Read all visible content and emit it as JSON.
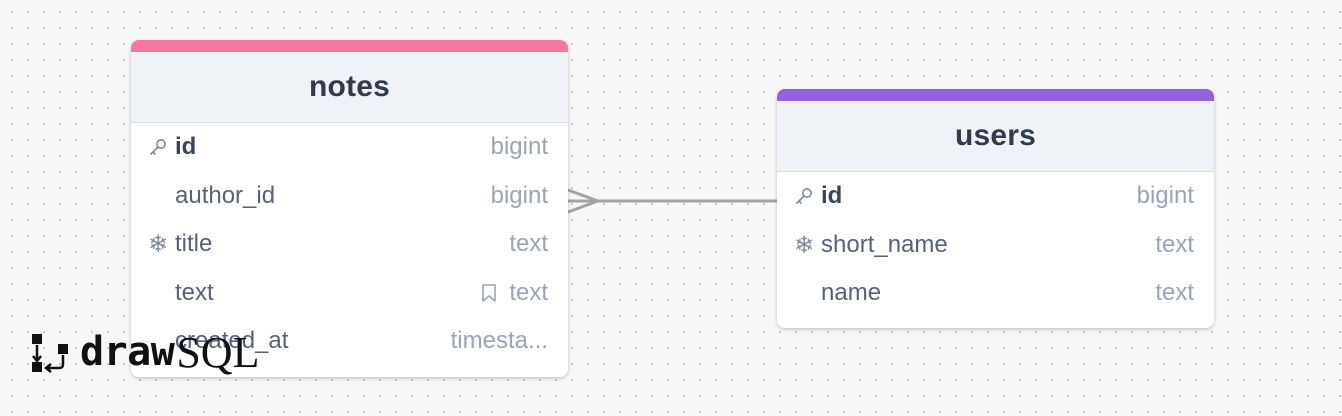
{
  "brand": {
    "logo_word_bold": "draw",
    "logo_word_light": "SQL"
  },
  "tables": {
    "notes": {
      "name": "notes",
      "accent_color": "#f7779e",
      "columns": [
        {
          "name": "id",
          "type": "bigint",
          "icon": "key-icon",
          "primary": true
        },
        {
          "name": "author_id",
          "type": "bigint",
          "icon": "",
          "primary": false
        },
        {
          "name": "title",
          "type": "text",
          "icon": "snowflake-icon",
          "primary": false
        },
        {
          "name": "text",
          "type": "text",
          "icon": "",
          "primary": false,
          "type_icon": "bookmark-icon"
        },
        {
          "name": "created_at",
          "type": "timesta...",
          "icon": "",
          "primary": false
        }
      ]
    },
    "users": {
      "name": "users",
      "accent_color": "#9461de",
      "columns": [
        {
          "name": "id",
          "type": "bigint",
          "icon": "key-icon",
          "primary": true
        },
        {
          "name": "short_name",
          "type": "text",
          "icon": "snowflake-icon",
          "primary": false
        },
        {
          "name": "name",
          "type": "text",
          "icon": "",
          "primary": false
        }
      ]
    }
  },
  "relation": {
    "from": "notes.author_id",
    "to": "users.id",
    "line_color": "#a3a3a3"
  }
}
